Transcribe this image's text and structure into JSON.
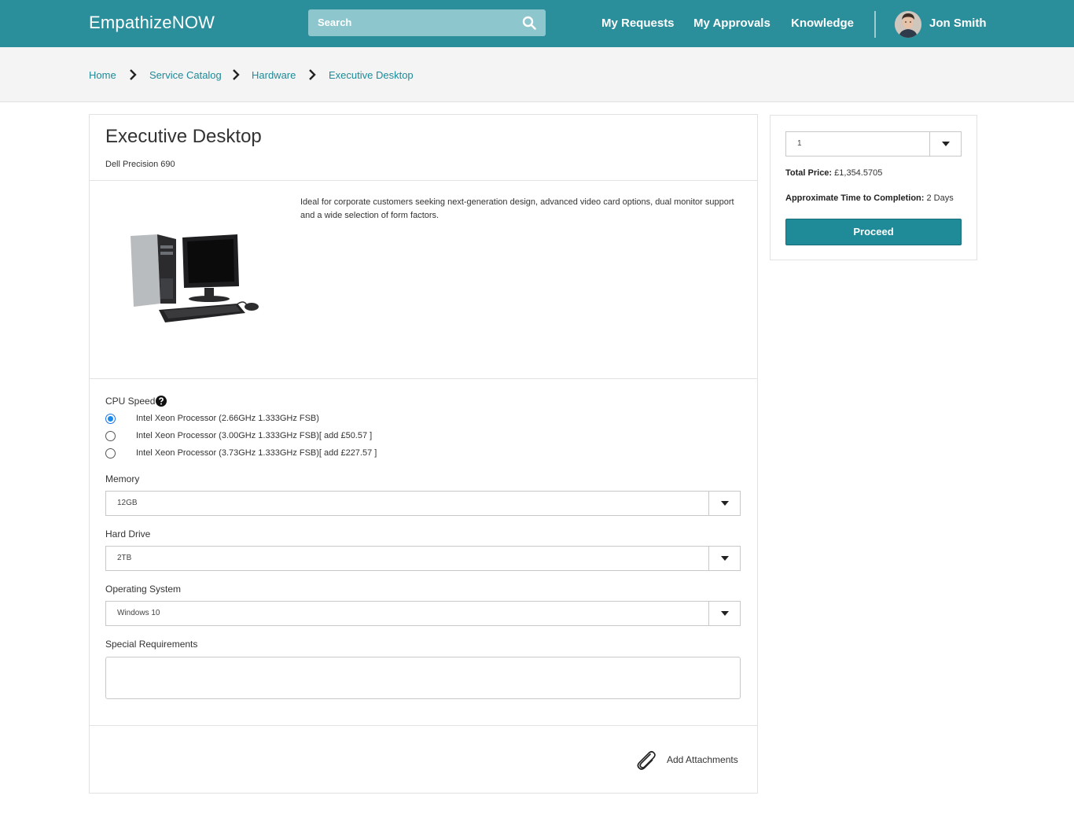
{
  "header": {
    "brand": "EmpathizeNOW",
    "search_placeholder": "Search",
    "nav": [
      "My Requests",
      "My Approvals",
      "Knowledge"
    ],
    "user_name": "Jon Smith",
    "bar_color": "#2b8e9b"
  },
  "breadcrumb": [
    "Home",
    "Service Catalog",
    "Hardware",
    "Executive Desktop"
  ],
  "item": {
    "title": "Executive Desktop",
    "subtitle": "Dell Precision 690",
    "description": "Ideal for corporate customers seeking next-generation design, advanced video card options, dual monitor support and a wide selection of form factors."
  },
  "form": {
    "cpu_label": "CPU Speed",
    "cpu_options": [
      {
        "label": "Intel Xeon Processor (2.66GHz 1.333GHz FSB)",
        "selected": true
      },
      {
        "label": "Intel Xeon Processor (3.00GHz 1.333GHz FSB)[ add £50.57 ]",
        "selected": false
      },
      {
        "label": "Intel Xeon Processor (3.73GHz 1.333GHz FSB)[ add £227.57 ]",
        "selected": false
      }
    ],
    "memory_label": "Memory",
    "memory_value": "12GB",
    "hard_drive_label": "Hard Drive",
    "hard_drive_value": "2TB",
    "os_label": "Operating System",
    "os_value": "Windows 10",
    "special_label": "Special Requirements",
    "special_value": "",
    "attach_label": "Add Attachments"
  },
  "order": {
    "quantity": "1",
    "total_price_label": "Total Price:",
    "total_price_value": "£1,354.5705",
    "time_label": "Approximate Time to Completion:",
    "time_value": "2 Days",
    "proceed_label": "Proceed",
    "accent": "#1f8a98"
  }
}
